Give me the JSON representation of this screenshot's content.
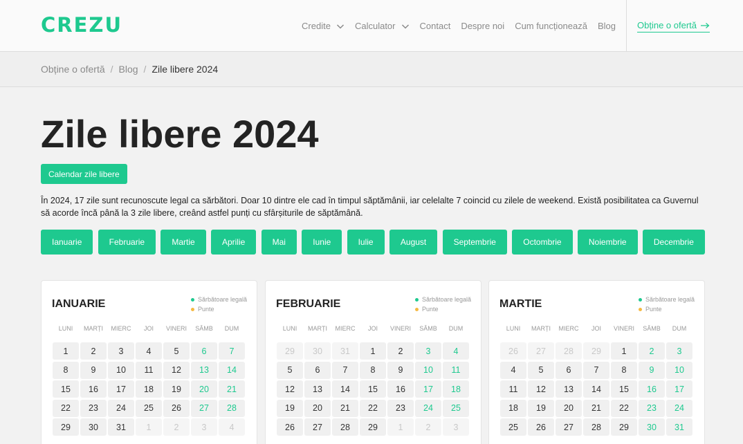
{
  "header": {
    "logo": "CREZU",
    "nav": [
      {
        "label": "Credite",
        "dropdown": true
      },
      {
        "label": "Calculator",
        "dropdown": true
      },
      {
        "label": "Contact",
        "dropdown": false
      },
      {
        "label": "Despre noi",
        "dropdown": false
      },
      {
        "label": "Cum funcționează",
        "dropdown": false
      },
      {
        "label": "Blog",
        "dropdown": false
      }
    ],
    "cta": "Obține o ofertă"
  },
  "breadcrumb": [
    "Obține o ofertă",
    "Blog",
    "Zile libere 2024"
  ],
  "page": {
    "title": "Zile libere 2024",
    "calendar_button": "Calendar zile libere",
    "intro": "În 2024, 17 zile sunt recunoscute legal ca sărbători. Doar 10 dintre ele cad în timpul săptămânii, iar celelalte 7 coincid cu zilele de weekend. Există posibilitatea ca Guvernul să acorde încă până la 3 zile libere, creând astfel punți cu sfârșiturile de săptămână."
  },
  "months": [
    "Ianuarie",
    "Februarie",
    "Martie",
    "Aprilie",
    "Mai",
    "Iunie",
    "Iulie",
    "August",
    "Septembrie",
    "Octombrie",
    "Noiembrie",
    "Decembrie"
  ],
  "legend": {
    "legal": "Sărbătoare legală",
    "bridge": "Punte",
    "legal_color": "#1ec98f",
    "bridge_color": "#f5b942"
  },
  "weekdays": [
    "LUNI",
    "MARȚI",
    "MIERC",
    "JOI",
    "VINERI",
    "SÂMB",
    "DUM"
  ],
  "colors": {
    "accent": "#1ec98f"
  },
  "calendars": [
    {
      "name": "IANUARIE",
      "days": [
        {
          "d": "1"
        },
        {
          "d": "2"
        },
        {
          "d": "3"
        },
        {
          "d": "4"
        },
        {
          "d": "5"
        },
        {
          "d": "6",
          "wk": true
        },
        {
          "d": "7",
          "wk": true
        },
        {
          "d": "8"
        },
        {
          "d": "9"
        },
        {
          "d": "10"
        },
        {
          "d": "11"
        },
        {
          "d": "12"
        },
        {
          "d": "13",
          "wk": true
        },
        {
          "d": "14",
          "wk": true
        },
        {
          "d": "15"
        },
        {
          "d": "16"
        },
        {
          "d": "17"
        },
        {
          "d": "18"
        },
        {
          "d": "19"
        },
        {
          "d": "20",
          "wk": true
        },
        {
          "d": "21",
          "wk": true
        },
        {
          "d": "22"
        },
        {
          "d": "23"
        },
        {
          "d": "24"
        },
        {
          "d": "25"
        },
        {
          "d": "26"
        },
        {
          "d": "27",
          "wk": true
        },
        {
          "d": "28",
          "wk": true
        },
        {
          "d": "29"
        },
        {
          "d": "30"
        },
        {
          "d": "31"
        },
        {
          "d": "1",
          "out": true
        },
        {
          "d": "2",
          "out": true
        },
        {
          "d": "3",
          "out": true
        },
        {
          "d": "4",
          "out": true
        }
      ]
    },
    {
      "name": "FEBRUARIE",
      "days": [
        {
          "d": "29",
          "out": true
        },
        {
          "d": "30",
          "out": true
        },
        {
          "d": "31",
          "out": true
        },
        {
          "d": "1"
        },
        {
          "d": "2"
        },
        {
          "d": "3",
          "wk": true
        },
        {
          "d": "4",
          "wk": true
        },
        {
          "d": "5"
        },
        {
          "d": "6"
        },
        {
          "d": "7"
        },
        {
          "d": "8"
        },
        {
          "d": "9"
        },
        {
          "d": "10",
          "wk": true
        },
        {
          "d": "11",
          "wk": true
        },
        {
          "d": "12"
        },
        {
          "d": "13"
        },
        {
          "d": "14"
        },
        {
          "d": "15"
        },
        {
          "d": "16"
        },
        {
          "d": "17",
          "wk": true
        },
        {
          "d": "18",
          "wk": true
        },
        {
          "d": "19"
        },
        {
          "d": "20"
        },
        {
          "d": "21"
        },
        {
          "d": "22"
        },
        {
          "d": "23"
        },
        {
          "d": "24",
          "wk": true
        },
        {
          "d": "25",
          "wk": true
        },
        {
          "d": "26"
        },
        {
          "d": "27"
        },
        {
          "d": "28"
        },
        {
          "d": "29"
        },
        {
          "d": "1",
          "out": true
        },
        {
          "d": "2",
          "out": true
        },
        {
          "d": "3",
          "out": true
        }
      ]
    },
    {
      "name": "MARTIE",
      "days": [
        {
          "d": "26",
          "out": true
        },
        {
          "d": "27",
          "out": true
        },
        {
          "d": "28",
          "out": true
        },
        {
          "d": "29",
          "out": true
        },
        {
          "d": "1"
        },
        {
          "d": "2",
          "wk": true
        },
        {
          "d": "3",
          "wk": true
        },
        {
          "d": "4"
        },
        {
          "d": "5"
        },
        {
          "d": "6"
        },
        {
          "d": "7"
        },
        {
          "d": "8"
        },
        {
          "d": "9",
          "wk": true
        },
        {
          "d": "10",
          "wk": true
        },
        {
          "d": "11"
        },
        {
          "d": "12"
        },
        {
          "d": "13"
        },
        {
          "d": "14"
        },
        {
          "d": "15"
        },
        {
          "d": "16",
          "wk": true
        },
        {
          "d": "17",
          "wk": true
        },
        {
          "d": "18"
        },
        {
          "d": "19"
        },
        {
          "d": "20"
        },
        {
          "d": "21"
        },
        {
          "d": "22"
        },
        {
          "d": "23",
          "wk": true
        },
        {
          "d": "24",
          "wk": true
        },
        {
          "d": "25"
        },
        {
          "d": "26"
        },
        {
          "d": "27"
        },
        {
          "d": "28"
        },
        {
          "d": "29"
        },
        {
          "d": "30",
          "wk": true
        },
        {
          "d": "31",
          "wk": true
        }
      ]
    }
  ]
}
